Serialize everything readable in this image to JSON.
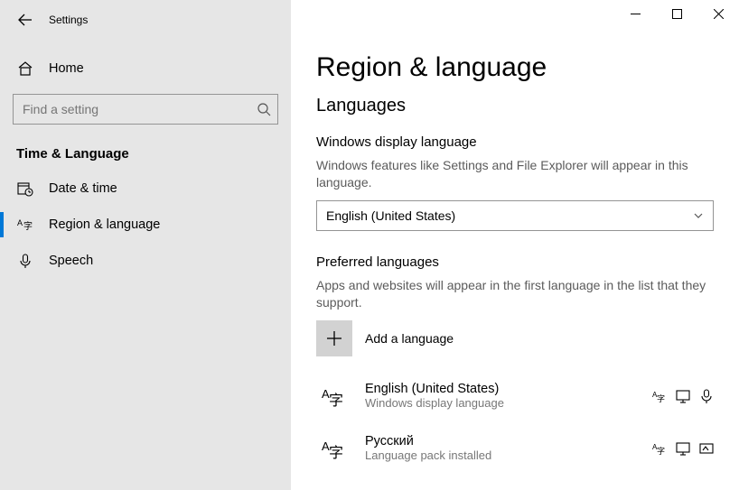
{
  "window_title": "Settings",
  "sidebar": {
    "home_label": "Home",
    "search_placeholder": "Find a setting",
    "section_title": "Time & Language",
    "items": [
      {
        "label": "Date & time"
      },
      {
        "label": "Region & language"
      },
      {
        "label": "Speech"
      }
    ]
  },
  "main": {
    "title": "Region & language",
    "languages_heading": "Languages",
    "display_lang_heading": "Windows display language",
    "display_lang_desc": "Windows features like Settings and File Explorer will appear in this language.",
    "display_lang_value": "English (United States)",
    "preferred_heading": "Preferred languages",
    "preferred_desc": "Apps and websites will appear in the first language in the list that they support.",
    "add_language_label": "Add a language",
    "languages": [
      {
        "name": "English (United States)",
        "subtitle": "Windows display language",
        "badges": [
          "langpack",
          "display",
          "speech"
        ]
      },
      {
        "name": "Русский",
        "subtitle": "Language pack installed",
        "badges": [
          "langpack",
          "display",
          "handwriting"
        ]
      }
    ]
  }
}
